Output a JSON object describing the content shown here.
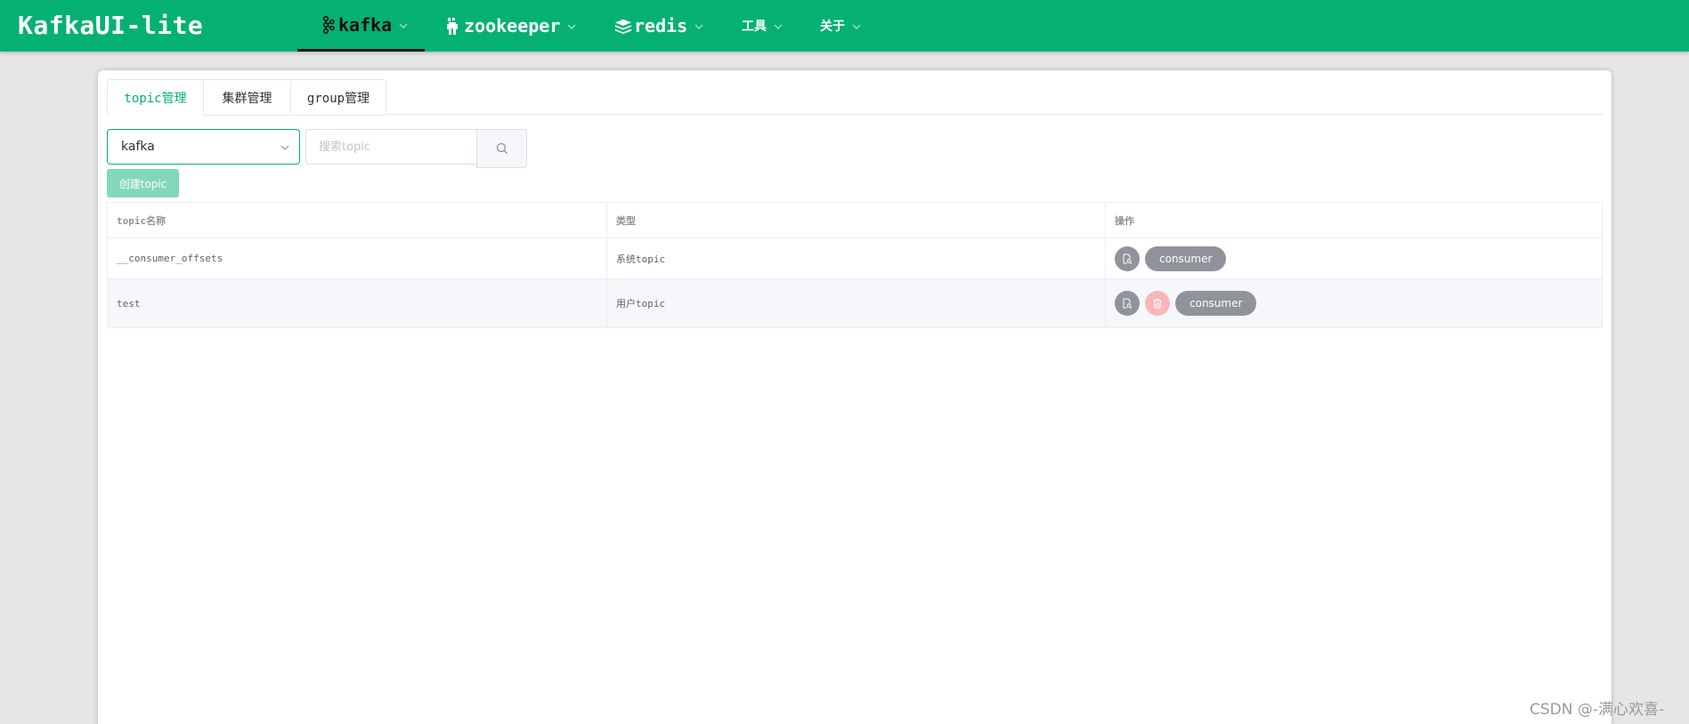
{
  "app": {
    "title": "KafkaUI-lite",
    "brand_color": "#04b173"
  },
  "nav": {
    "items": [
      {
        "label": "kafka",
        "icon": "kafka-icon",
        "active": true
      },
      {
        "label": "zookeeper",
        "icon": "zookeeper-icon",
        "active": false
      },
      {
        "label": "redis",
        "icon": "redis-icon",
        "active": false
      },
      {
        "label": "工具",
        "active": false
      },
      {
        "label": "关于",
        "active": false
      }
    ]
  },
  "tabs": [
    {
      "label": "topic管理",
      "active": true
    },
    {
      "label": "集群管理",
      "active": false
    },
    {
      "label": "group管理",
      "active": false
    }
  ],
  "controls": {
    "cluster_select_value": "kafka",
    "search_placeholder": "搜索topic",
    "create_button_label": "创建topic"
  },
  "table": {
    "columns": [
      "topic名称",
      "类型",
      "操作"
    ],
    "rows": [
      {
        "name": "__consumer_offsets",
        "type": "系统topic",
        "action_label": "consumer",
        "deletable": false
      },
      {
        "name": "test",
        "type": "用户topic",
        "action_label": "consumer",
        "deletable": true
      }
    ]
  },
  "watermark": "CSDN @-满心欢喜-"
}
